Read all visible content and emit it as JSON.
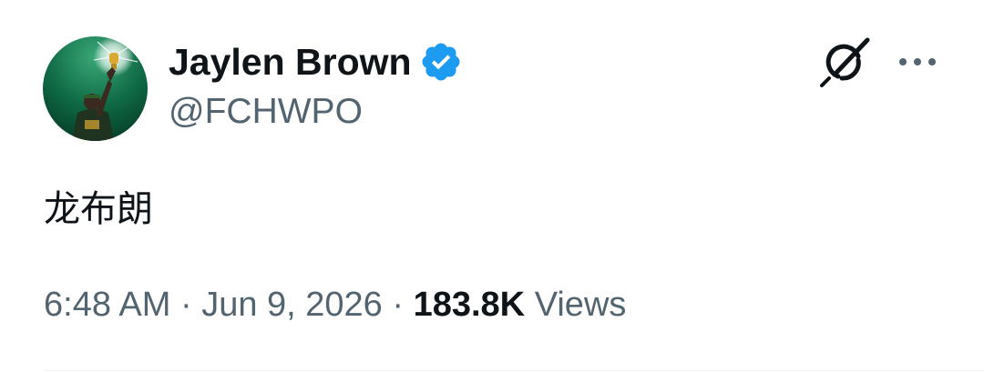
{
  "author": {
    "display_name": "Jaylen Brown",
    "handle": "@FCHWPO",
    "verified": true
  },
  "tweet": {
    "text": "龙布朗",
    "time": "6:48 AM",
    "separator": "·",
    "date": "Jun 9, 2026",
    "views_count": "183.8K",
    "views_label": "Views"
  },
  "icons": {
    "verified": "verified-badge-icon",
    "grok": "grok-icon",
    "more": "more-options-icon"
  },
  "colors": {
    "verified_blue": "#1d9bf0",
    "secondary_text": "#536471",
    "primary_text": "#0f1419"
  }
}
